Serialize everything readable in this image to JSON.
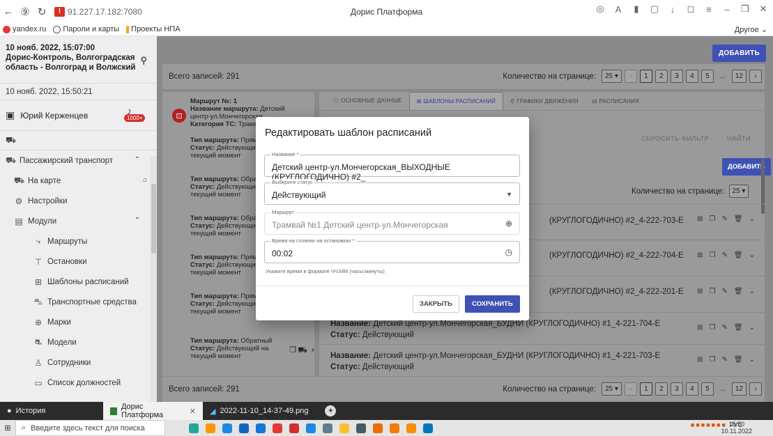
{
  "browser": {
    "url_host": "91.227.17.182:7080",
    "tab_title": "Дорис Платформа",
    "bookmarks": [
      "yandex.ru",
      "Пароли и карты",
      "Проекты НПА"
    ],
    "bookmarks_other": "Другое"
  },
  "sidebar": {
    "header_line1": "10 нояб. 2022, 15:07:00",
    "header_line2": "Дорис-Контроль, Волгоградская",
    "header_line3": "область - Волгоград и Волжский",
    "time2": "10 нояб. 2022, 15:50:21",
    "user": "Юрий Керженцев",
    "badge": "1000+",
    "items": [
      {
        "label": "Пассажирский транспорт",
        "icon": "bus-icon"
      },
      {
        "label": "На карте",
        "icon": "map-icon"
      },
      {
        "label": "Настройки",
        "icon": "gear-icon"
      },
      {
        "label": "Модули",
        "icon": "modules-icon"
      },
      {
        "label": "Маршруты",
        "icon": "route-icon"
      },
      {
        "label": "Остановки",
        "icon": "stop-icon"
      },
      {
        "label": "Шаблоны расписаний",
        "icon": "grid-icon"
      },
      {
        "label": "Транспортные средства",
        "icon": "vehicle-icon"
      },
      {
        "label": "Марки",
        "icon": "brand-icon"
      },
      {
        "label": "Модели",
        "icon": "model-icon"
      },
      {
        "label": "Сотрудники",
        "icon": "person-icon"
      },
      {
        "label": "Список должностей",
        "icon": "list-icon"
      }
    ]
  },
  "main": {
    "add_label": "ДОБАВИТЬ",
    "total": "Всего записей: 291",
    "per_page_label": "Количество на странице:",
    "per_page": "25",
    "pages": [
      "1",
      "2",
      "3",
      "4",
      "5",
      "...",
      "12"
    ],
    "routes": [
      {
        "l1": "Маршрут №: 1",
        "l2": "Название маршрута:",
        "l2v": " Детский",
        "l3": "центр-ул.Мончегорская",
        "l4": "Категория ТС:",
        "l4v": " Трамвай"
      },
      {
        "type": "Прямой",
        "status": "Действующий на",
        "moment": "текущий момент"
      },
      {
        "type": "Обратный",
        "status": "Действующий на",
        "moment": "текущий момент"
      },
      {
        "type": "Обратный",
        "status": "Действующий на",
        "moment": "текущий момент"
      },
      {
        "type": "Прямой",
        "status": "Действующий на",
        "moment": "текущий момент"
      },
      {
        "type": "Прямой",
        "status": "Действующий на",
        "moment": "текущий момент"
      },
      {
        "type": "Обратный",
        "status": "Действующий на",
        "moment": "текущий момент"
      }
    ],
    "route_type_label": "Тип маршрута:",
    "route_status_label": "Статус:",
    "tabs": [
      "ОСНОВНЫЕ ДАННЫЕ",
      "ШАБЛОНЫ РАСПИСАНИЙ",
      "ГРАФИКИ ДВИЖЕНИЯ",
      "РАСПИСАНИЯ"
    ],
    "reset_filter": "СБРОСИТЬ ФИЛЬТР",
    "find": "НАЙТИ",
    "rows": [
      {
        "name": "(КРУГЛОГОДИЧНО) #2_4-222-703-E",
        "status": ""
      },
      {
        "name": "(КРУГЛОГОДИЧНО) #2_4-222-704-E",
        "status": ""
      },
      {
        "name": "(КРУГЛОГОДИЧНО) #2_4-222-201-E",
        "status": ""
      },
      {
        "name": "Детский центр-ул.Мончегорская_БУДНИ (КРУГЛОГОДИЧНО) #1_4-221-704-E",
        "status": "Действующий"
      },
      {
        "name": "Детский центр-ул.Мончегорская_БУДНИ (КРУГЛОГОДИЧНО) #1_4-221-703-E",
        "status": "Действующий"
      }
    ],
    "name_label": "Название:",
    "status_label": "Статус:"
  },
  "modal": {
    "title": "Редактировать шаблон расписаний",
    "name_label": "Название *",
    "name_value": "Детский центр-ул.Мончегорская_ВЫХОДНЫЕ (КРУГЛОГОДИЧНО) #2_",
    "status_label": "Выберите статус",
    "status_value": "Действующий",
    "route_label": "Маршрут",
    "route_value": "Трамвай №1 Детский центр-ул.Мончегорская",
    "time_label": "Время на стоянки на остановках *",
    "time_value": "00:02",
    "hint": "Укажите время в формате ЧЧ:ММ (часы:минуты)",
    "close": "ЗАКРЫТЬ",
    "save": "СОХРАНИТЬ"
  },
  "taskbar": {
    "history": "История",
    "tab1": "Дорис Платформа",
    "tab2": "2022-11-10_14-37-49.png",
    "search": "Введите здесь текст для поиска",
    "lang": "РУС",
    "time": "15:50",
    "date": "10.11.2022"
  }
}
